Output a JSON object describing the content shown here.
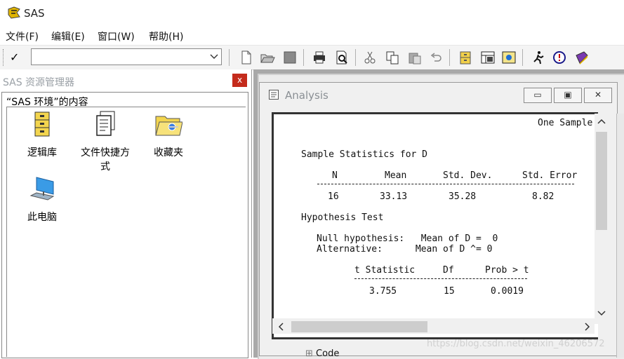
{
  "window": {
    "title": "SAS"
  },
  "menu": [
    "文件(F)",
    "编辑(E)",
    "窗口(W)",
    "帮助(H)"
  ],
  "toolbar": {
    "check_glyph": "✓",
    "command_value": "",
    "icons": [
      "new-icon",
      "open-icon",
      "save-icon",
      "print-icon",
      "print-preview-icon",
      "cut-icon",
      "copy-icon",
      "paste-icon",
      "undo-icon",
      "libraries-icon",
      "explorer-icon",
      "results-icon",
      "run-icon",
      "help-icon",
      "docs-icon"
    ]
  },
  "explorer": {
    "title": "SAS 资源管理器",
    "close_label": "x",
    "subtitle": "“SAS 环境”的内容",
    "items": [
      {
        "label": "逻辑库",
        "icon": "library-cabinet-icon"
      },
      {
        "label": "文件快捷方式",
        "icon": "file-shortcut-icon"
      },
      {
        "label": "收藏夹",
        "icon": "favorites-folder-icon"
      },
      {
        "label": "此电脑",
        "icon": "computer-icon"
      }
    ]
  },
  "analysis": {
    "title": "Analysis",
    "buttons": {
      "minimize": "▭",
      "restore": "▣",
      "close": "✕"
    },
    "output": {
      "header_right": "One Sample",
      "section1": "Sample Statistics for D",
      "stats_headers": [
        "N",
        "Mean",
        "Std. Dev.",
        "Std. Error"
      ],
      "stats_values": [
        "16",
        "33.13",
        "35.28",
        "8.82"
      ],
      "section2": "Hypothesis Test",
      "null_line": "Null hypothesis:   Mean of D =  0",
      "alt_line": "Alternative:      Mean of D ^= 0",
      "test_headers": [
        "t Statistic",
        "Df",
        "Prob > t"
      ],
      "test_values": [
        "3.755",
        "15",
        "0.0019"
      ]
    }
  },
  "tree_peek": "Code",
  "watermark": "https://blog.csdn.net/weixin_46206572"
}
